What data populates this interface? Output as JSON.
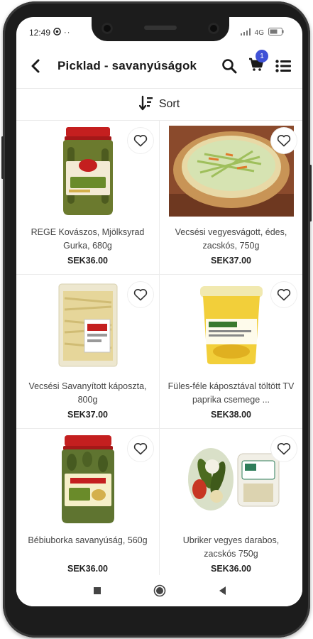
{
  "status": {
    "time": "12:49",
    "network": "4G",
    "icons": [
      "whatsapp-icon",
      "more-dots-icon",
      "signal-icon",
      "battery-icon"
    ]
  },
  "header": {
    "title": "Picklad - savanyúságok",
    "cart_count": "1",
    "icons": [
      "back-arrow-icon",
      "search-icon",
      "cart-icon",
      "list-view-icon"
    ]
  },
  "sort": {
    "label": "Sort",
    "icon": "sort-icon"
  },
  "products": [
    {
      "name": "REGE Kovászos, Mjölksyrad Gurka, 680g",
      "price": "SEK36.00",
      "image": "jar-pickles-rege"
    },
    {
      "name": "Vecsési vegyesvágott, édes, zacskós, 750g",
      "price": "SEK37.00",
      "image": "mixed-cabbage-bowl"
    },
    {
      "name": "Vecsési Savanyított káposzta, 800g",
      "price": "SEK37.00",
      "image": "sauerkraut-bag"
    },
    {
      "name": "Füles-féle káposztával töltött TV paprika csemege ...",
      "price": "SEK38.00",
      "image": "stuffed-pepper-tub"
    },
    {
      "name": "Bébiuborka savanyúság, 560g",
      "price": "SEK36.00",
      "image": "baby-cucumber-jar"
    },
    {
      "name": "Ubriker vegyes darabos, zacskós 750g",
      "price": "SEK36.00",
      "image": "mixed-pickles-bag"
    }
  ],
  "colors": {
    "accent": "#3f51d6",
    "text": "#1a1a1a",
    "divider": "#ececec"
  },
  "nav": [
    "recent-apps-icon",
    "home-icon",
    "back-icon"
  ]
}
